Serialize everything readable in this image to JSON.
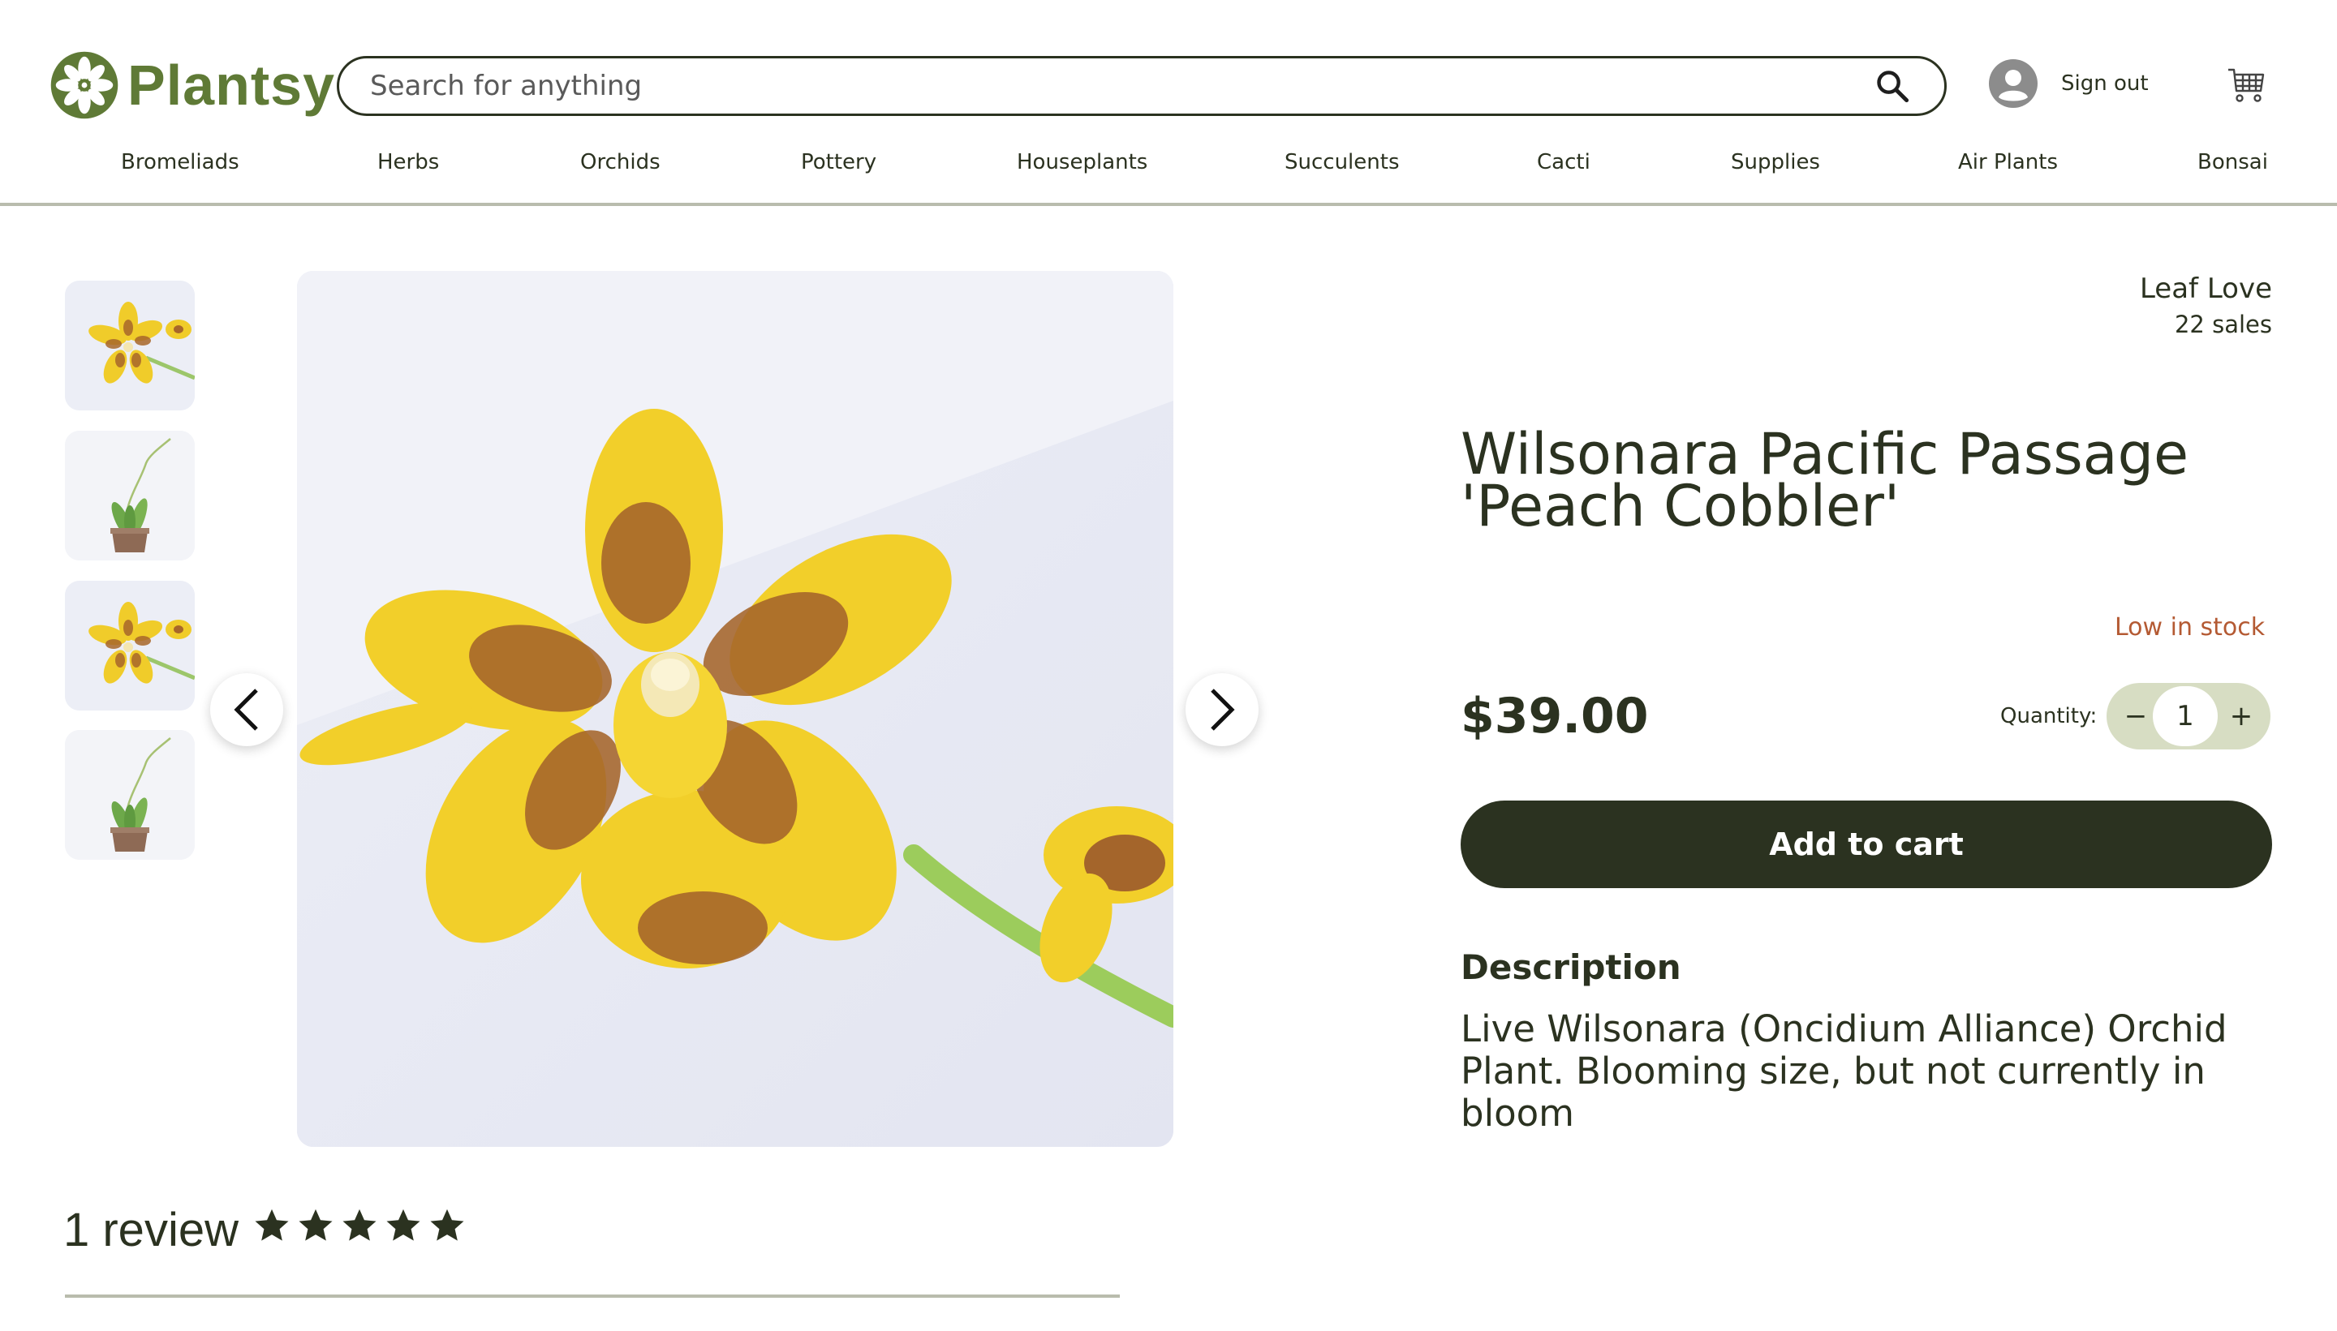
{
  "header": {
    "logo_text": "Plantsy",
    "search": {
      "placeholder": "Search for anything",
      "value": ""
    },
    "icons": {
      "search": "search-icon",
      "account": "account-icon",
      "cart": "cart-icon"
    },
    "sign_out_label": "Sign out"
  },
  "nav": {
    "items": [
      {
        "label": "Bromeliads"
      },
      {
        "label": "Herbs"
      },
      {
        "label": "Orchids"
      },
      {
        "label": "Pottery"
      },
      {
        "label": "Houseplants"
      },
      {
        "label": "Succulents"
      },
      {
        "label": "Cacti"
      },
      {
        "label": "Supplies"
      },
      {
        "label": "Air Plants"
      },
      {
        "label": "Bonsai"
      }
    ]
  },
  "gallery": {
    "thumbnails": [
      "orchid-flower-closeup",
      "orchid-plant-in-pot",
      "orchid-flower-closeup",
      "orchid-plant-in-pot"
    ],
    "main_image": "orchid-flower-closeup",
    "icons": {
      "prev": "chevron-left-icon",
      "next": "chevron-right-icon"
    }
  },
  "product": {
    "seller_name": "Leaf Love",
    "seller_sales": "22 sales",
    "title": "Wilsonara Pacific Passage 'Peach Cobbler'",
    "stock_status": "Low in stock",
    "price": "$39.00",
    "quantity_label": "Quantity:",
    "quantity_value": "1",
    "quantity_minus": "−",
    "quantity_plus": "+",
    "add_to_cart_label": "Add to cart",
    "description_heading": "Description",
    "description_text": "Live Wilsonara (Oncidium Alliance) Orchid Plant. Blooming size, but not currently in bloom"
  },
  "reviews": {
    "count_label": "1 review",
    "rating": 5,
    "max_rating": 5
  },
  "colors": {
    "brand_green": "#5f7a36",
    "dark_olive": "#2b3220",
    "stock_warning": "#b45a33",
    "quantity_bg": "#d7ddc3",
    "divider": "#b9bcad"
  }
}
